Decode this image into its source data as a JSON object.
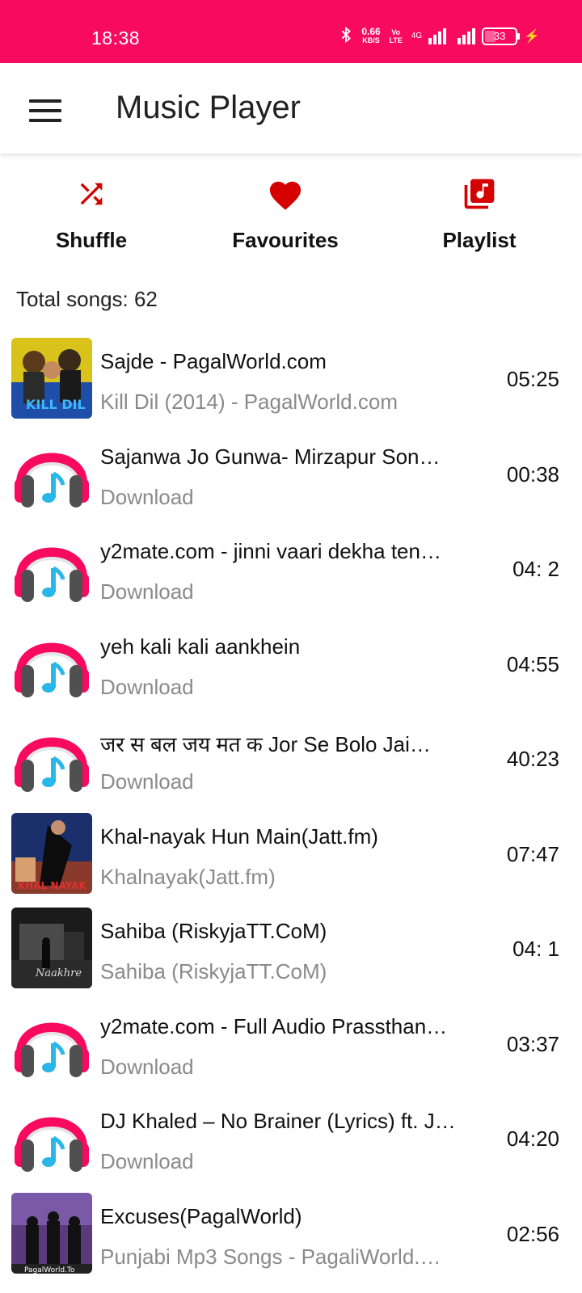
{
  "status": {
    "time": "18:38",
    "net_speed": "0.66",
    "net_unit": "KB/S",
    "volte": "Vo LTE",
    "network": "4G",
    "battery": "33"
  },
  "header": {
    "title": "Music Player"
  },
  "quick_actions": [
    {
      "label": "Shuffle"
    },
    {
      "label": "Favourites"
    },
    {
      "label": "Playlist"
    }
  ],
  "summary": {
    "total_songs": "Total songs: 62"
  },
  "songs": [
    {
      "title": "Sajde - PagalWorld.com",
      "subtitle": "Kill Dil (2014) - PagalWorld.com",
      "duration": "05:25",
      "art": "album-art"
    },
    {
      "title": "Sajanwa Jo Gunwa- Mirzapur Son…",
      "subtitle": "Download",
      "duration": "00:38",
      "art": "headphones"
    },
    {
      "title": "y2mate.com - jinni vaari dekha ten…",
      "subtitle": "Download",
      "duration": "04: 2",
      "art": "headphones"
    },
    {
      "title": "yeh kali kali aankhein",
      "subtitle": "Download",
      "duration": "04:55",
      "art": "headphones"
    },
    {
      "title": "जर स बल जय मत क Jor Se Bolo Jai…",
      "subtitle": "Download",
      "duration": "40:23",
      "art": "headphones"
    },
    {
      "title": "Khal-nayak Hun Main(Jatt.fm)",
      "subtitle": "Khalnayak(Jatt.fm)",
      "duration": "07:47",
      "art": "album-art"
    },
    {
      "title": "Sahiba (RiskyjaTT.CoM)",
      "subtitle": "Sahiba (RiskyjaTT.CoM)",
      "duration": "04: 1",
      "art": "album-art"
    },
    {
      "title": "y2mate.com - Full Audio Prassthan…",
      "subtitle": "Download",
      "duration": "03:37",
      "art": "headphones"
    },
    {
      "title": "DJ Khaled – No Brainer (Lyrics) ft. J…",
      "subtitle": "Download",
      "duration": "04:20",
      "art": "headphones"
    },
    {
      "title": "Excuses(PagalWorld)",
      "subtitle": "Punjabi Mp3 Songs - PagaliWorld.…",
      "duration": "02:56",
      "art": "album-art"
    }
  ],
  "colors": {
    "accent": "#F80A5F",
    "icon_red": "#D50000"
  }
}
